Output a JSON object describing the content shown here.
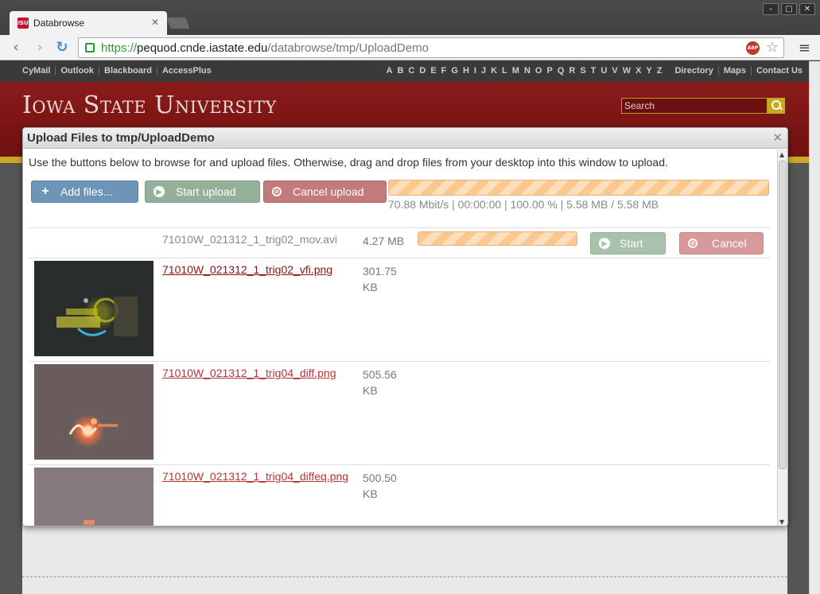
{
  "browser": {
    "tab_title": "Databrowse",
    "favicon": "ISU",
    "url_scheme": "https://",
    "url_host": "pequod.cnde.iastate.edu",
    "url_path": "/databrowse/tmp/UploadDemo",
    "adblock_label": "ABP"
  },
  "utility_nav": {
    "left_links": [
      "CyMail",
      "Outlook",
      "Blackboard",
      "AccessPlus"
    ],
    "letters": [
      "A",
      "B",
      "C",
      "D",
      "E",
      "F",
      "G",
      "H",
      "I",
      "J",
      "K",
      "L",
      "M",
      "N",
      "O",
      "P",
      "Q",
      "R",
      "S",
      "T",
      "U",
      "V",
      "W",
      "X",
      "Y",
      "Z"
    ],
    "right_links": [
      "Directory",
      "Maps",
      "Contact Us"
    ]
  },
  "header": {
    "university_title": "Iowa State University",
    "search_placeholder": "Search"
  },
  "dialog": {
    "title": "Upload Files to tmp/UploadDemo",
    "instructions": "Use the buttons below to browse for and upload files. Otherwise, drag and drop files from your desktop into this window to upload.",
    "add_files_label": "Add files...",
    "start_upload_label": "Start upload",
    "cancel_upload_label": "Cancel upload",
    "global_progress_percent": 100,
    "progress_stats": "70.88 Mbit/s | 00:00:00 | 100.00 % | 5.58 MB / 5.58 MB",
    "files": [
      {
        "name": "71010W_021312_1_trig02_mov.avi",
        "size": "4.27 MB",
        "progress_percent": 100,
        "start_label": "Start",
        "cancel_label": "Cancel"
      },
      {
        "name": "71010W_021312_1_trig02_vfi.png",
        "size_value": "301.75",
        "size_unit": "KB"
      },
      {
        "name": "71010W_021312_1_trig04_diff.png",
        "size_value": "505.56",
        "size_unit": "KB"
      },
      {
        "name": "71010W_021312_1_trig04_diffeq.png",
        "size_value": "500.50",
        "size_unit": "KB"
      }
    ]
  },
  "colors": {
    "isu_red": "#8b1b1b",
    "isu_gold": "#c9a822",
    "add_button": "#6d95b8",
    "start_button": "#93b09a",
    "cancel_button": "#c27a7a",
    "progress": "#fbc98f"
  }
}
